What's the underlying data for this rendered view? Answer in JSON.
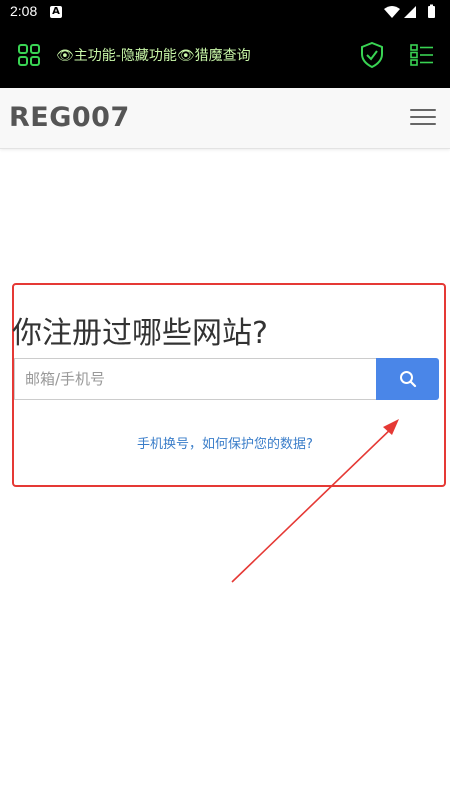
{
  "status_bar": {
    "time": "2:08",
    "notification_badge": "A"
  },
  "app_bar": {
    "title": "👁主功能-隐藏功能👁猎魔查询",
    "accent_color": "#39d353",
    "icons": [
      "grid-icon",
      "shield-check-icon",
      "list-icon"
    ]
  },
  "site": {
    "logo": "REG007"
  },
  "search": {
    "question": "你注册过哪些网站?",
    "placeholder": "邮箱/手机号",
    "value": "",
    "button_color": "#4a86e8"
  },
  "privacy_link": "手机换号，如何保护您的数据?",
  "annotation": {
    "box_color": "#e53935",
    "arrow_color": "#e53935"
  }
}
